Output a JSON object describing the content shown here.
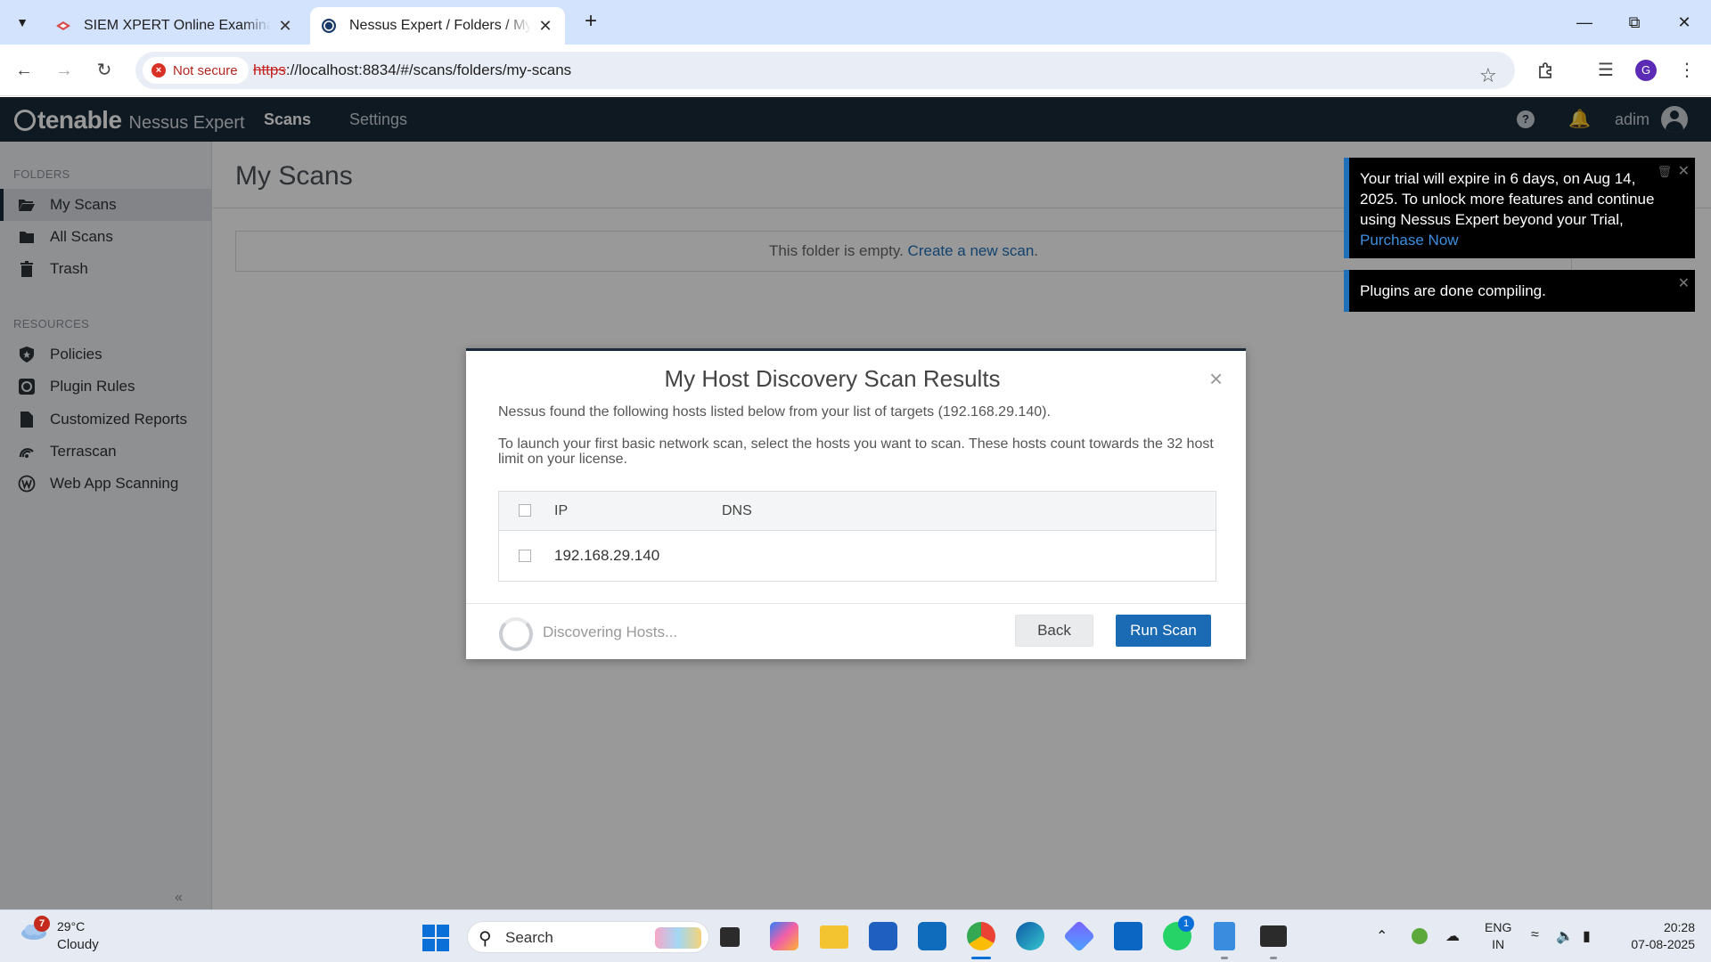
{
  "browser": {
    "tabs": [
      {
        "title": "SIEM XPERT Online Examination",
        "active": false
      },
      {
        "title": "Nessus Expert / Folders / My Scans",
        "active": true
      }
    ],
    "security_label": "Not secure",
    "url_scheme": "https",
    "url_rest": "://localhost:8834/#/scans/folders/my-scans",
    "profile_initial": "G"
  },
  "app": {
    "brand": "tenable",
    "product": "Nessus Expert",
    "nav": {
      "scans": "Scans",
      "settings": "Settings"
    },
    "user": "adim"
  },
  "sidebar": {
    "folders_heading": "FOLDERS",
    "folders": [
      {
        "label": "My Scans",
        "icon": "folder-open-icon",
        "active": true
      },
      {
        "label": "All Scans",
        "icon": "folder-icon",
        "active": false
      },
      {
        "label": "Trash",
        "icon": "trash-icon",
        "active": false
      }
    ],
    "resources_heading": "RESOURCES",
    "resources": [
      {
        "label": "Policies",
        "icon": "shield-icon"
      },
      {
        "label": "Plugin Rules",
        "icon": "plugin-rules-icon"
      },
      {
        "label": "Customized Reports",
        "icon": "report-icon"
      },
      {
        "label": "Terrascan",
        "icon": "terrascan-icon"
      },
      {
        "label": "Web App Scanning",
        "icon": "web-app-icon"
      }
    ]
  },
  "main": {
    "title": "My Scans",
    "empty_text": "This folder is empty.",
    "empty_link": "Create a new scan",
    "empty_suffix": "."
  },
  "modal": {
    "title": "My Host Discovery Scan Results",
    "text1": "Nessus found the following hosts listed below from your list of targets (192.168.29.140).",
    "text2": "To launch your first basic network scan, select the hosts you want to scan. These hosts count towards the 32 host limit on your license.",
    "columns": {
      "ip": "IP",
      "dns": "DNS"
    },
    "rows": [
      {
        "ip": "192.168.29.140",
        "dns": ""
      }
    ],
    "status": "Discovering Hosts...",
    "back_label": "Back",
    "run_label": "Run Scan"
  },
  "toasts": {
    "trial_text": "Your trial will expire in 6 days, on Aug 14, 2025. To unlock more features and continue using Nessus Expert beyond your Trial,",
    "trial_link": "Purchase Now",
    "plugins_text": "Plugins are done compiling."
  },
  "taskbar": {
    "weather_badge": "7",
    "temperature": "29°C",
    "condition": "Cloudy",
    "search_placeholder": "Search",
    "whatsapp_badge": "1",
    "lang_line1": "ENG",
    "lang_line2": "IN",
    "time": "20:28",
    "date": "07-08-2025"
  },
  "colors": {
    "header_bg": "#1a2a3a",
    "accent_blue": "#1a6bb3",
    "link_blue": "#1e6fb8",
    "not_secure_red": "#d93025"
  }
}
